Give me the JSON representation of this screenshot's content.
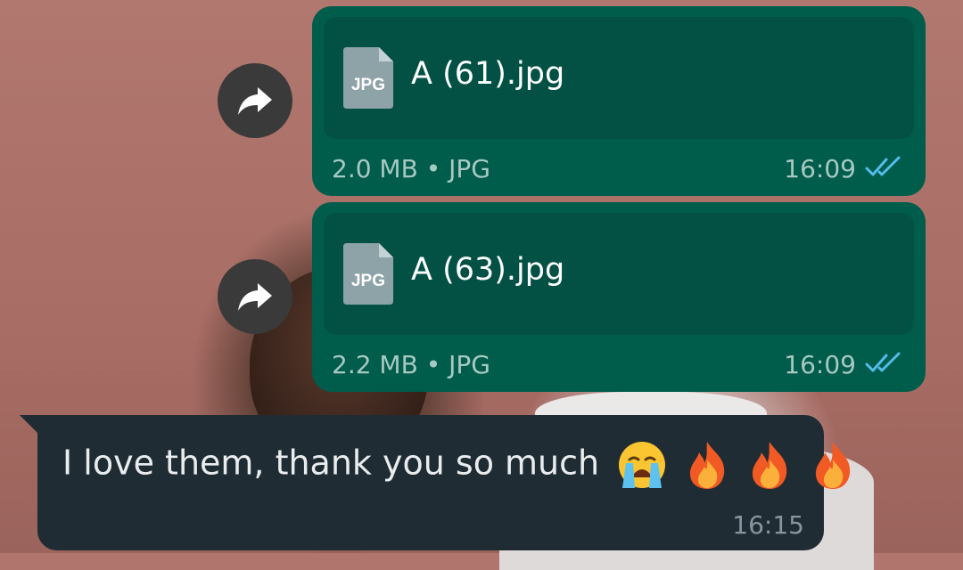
{
  "messages": [
    {
      "type": "document",
      "direction": "outgoing",
      "forwardable": true,
      "file_type_label": "JPG",
      "file_name": "A (61).jpg",
      "meta": "2.0 MB • JPG",
      "time": "16:09",
      "status": "read",
      "status_icon": "double-check-icon"
    },
    {
      "type": "document",
      "direction": "outgoing",
      "forwardable": true,
      "file_type_label": "JPG",
      "file_name": "A (63).jpg",
      "meta": "2.2 MB • JPG",
      "time": "16:09",
      "status": "read",
      "status_icon": "double-check-icon"
    },
    {
      "type": "text",
      "direction": "incoming",
      "text": "I love them, thank you so much",
      "emojis": [
        "loudly-crying-face",
        "fire",
        "fire",
        "fire"
      ],
      "time": "16:15"
    }
  ],
  "colors": {
    "outgoing_bubble": "#005c4b",
    "outgoing_inner": "#025144",
    "incoming_bubble": "#202c33",
    "read_ticks": "#53bdeb",
    "forward_button": "#3b3a3a"
  }
}
